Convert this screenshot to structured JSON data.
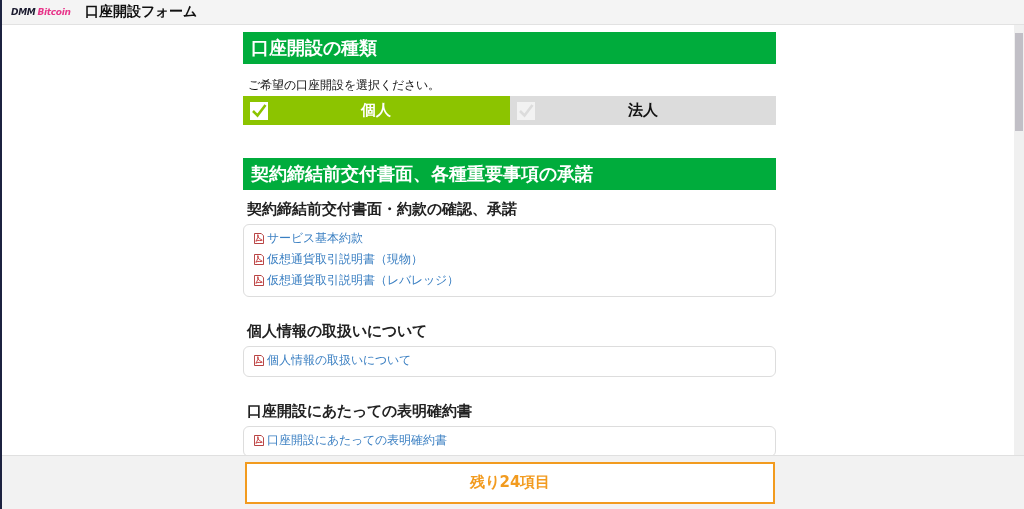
{
  "header": {
    "logo_dmm": "DMM",
    "logo_bitcoin": "Bitcoin",
    "title": "口座開設フォーム"
  },
  "sections": [
    {
      "title": "口座開設の種類",
      "blocks": [
        {
          "kind": "instruction",
          "text": "ご希望の口座開設を選択ください。"
        },
        {
          "kind": "choice",
          "options": [
            {
              "label": "個人",
              "selected": true
            },
            {
              "label": "法人",
              "selected": false
            }
          ]
        }
      ]
    },
    {
      "title": "契約締結前交付書面、各種重要事項の承諾",
      "blocks": [
        {
          "kind": "subheading",
          "text": "契約締結前交付書面・約款の確認、承諾"
        },
        {
          "kind": "documents",
          "items": [
            "サービス基本約款",
            "仮想通貨取引説明書（現物）",
            "仮想通貨取引説明書（レバレッジ）"
          ]
        },
        {
          "kind": "subheading",
          "text": "個人情報の取扱いについて"
        },
        {
          "kind": "documents",
          "items": [
            "個人情報の取扱いについて"
          ]
        },
        {
          "kind": "subheading",
          "text": "口座開設にあたっての表明確約書"
        },
        {
          "kind": "documents",
          "items": [
            "口座開設にあたっての表明確約書"
          ]
        }
      ]
    }
  ],
  "footer": {
    "remaining": "残り24項目"
  }
}
